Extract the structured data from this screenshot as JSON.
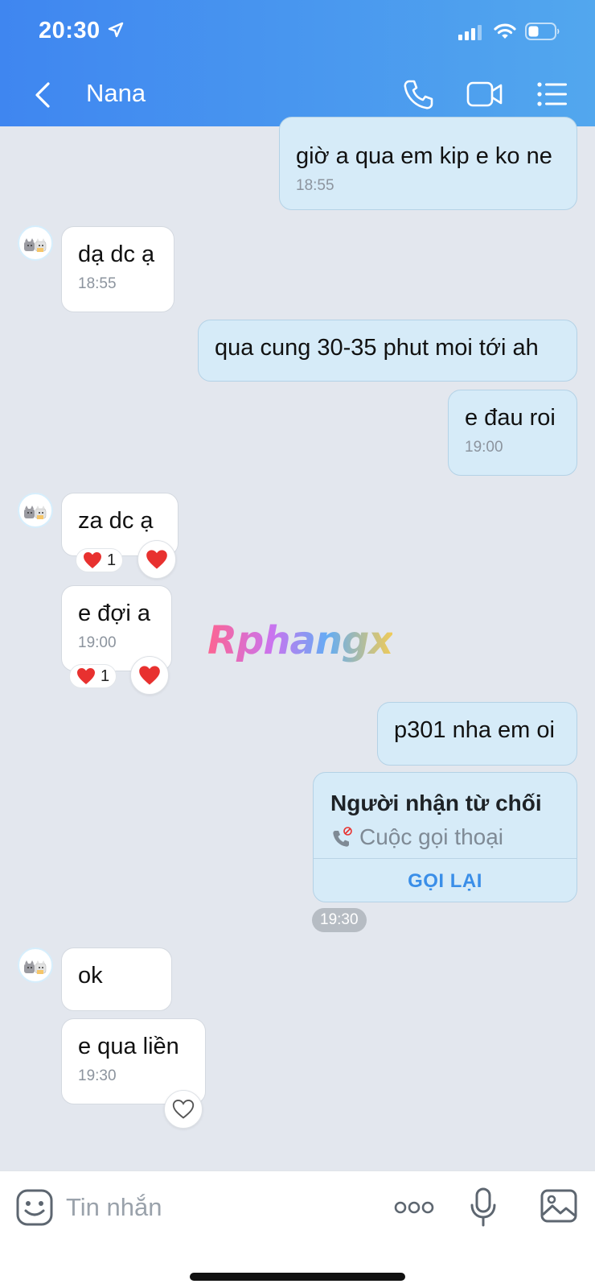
{
  "status_bar": {
    "time": "20:30"
  },
  "header": {
    "title": "Nana"
  },
  "messages": [
    {
      "text": "giờ a qua em kip e ko ne",
      "time": "18:55"
    },
    {
      "text": "dạ dc ạ",
      "time": "18:55"
    },
    {
      "text": "qua cung 30-35 phut moi tới ah"
    },
    {
      "text": "e đau roi",
      "time": "19:00"
    },
    {
      "text": "za dc ạ",
      "reaction_count": "1"
    },
    {
      "text": "e đợi a",
      "time": "19:00",
      "reaction_count": "1"
    },
    {
      "text": "p301 nha em oi"
    },
    {
      "text": "ok"
    },
    {
      "text": "e qua liền",
      "time": "19:30"
    }
  ],
  "call_card": {
    "title": "Người nhận từ chối",
    "subtitle": "Cuộc gọi thoại",
    "action": "GỌI LẠI",
    "time": "19:30"
  },
  "watermark": "Rphangx",
  "input": {
    "placeholder": "Tin nhắn"
  },
  "colors": {
    "header_start": "#3f86f0",
    "header_end": "#52a7ee",
    "outgoing": "#d6ebf8",
    "incoming": "#ffffff",
    "accent": "#3a8ee8",
    "heart": "#e8312f"
  },
  "icons": [
    "location-arrow-icon",
    "signal-icon",
    "wifi-icon",
    "battery-icon",
    "back-icon",
    "phone-icon",
    "video-icon",
    "list-menu-icon",
    "heart-icon",
    "missed-call-icon",
    "emoji-icon",
    "more-icon",
    "mic-icon",
    "image-icon"
  ]
}
